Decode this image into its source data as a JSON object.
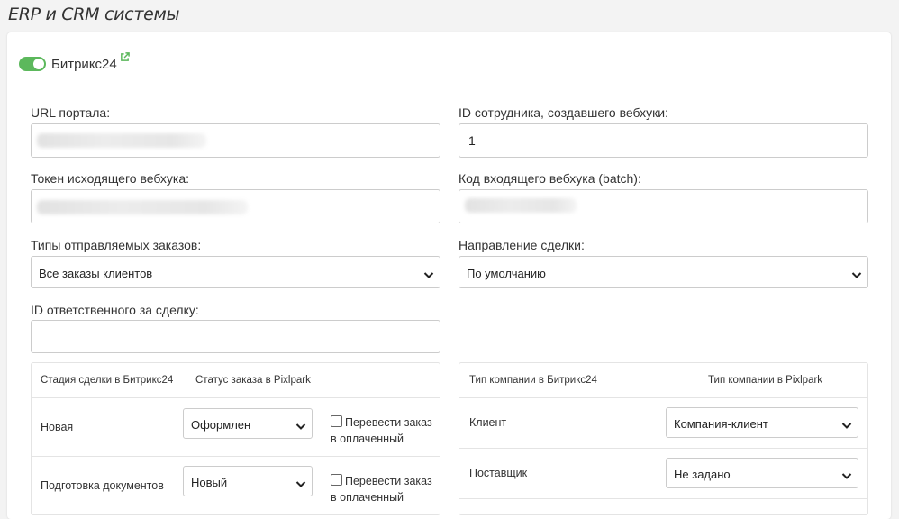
{
  "page": {
    "title": "ERP и CRM системы"
  },
  "integration": {
    "name": "Битрикс24",
    "enabled": true
  },
  "fields": {
    "portal_url": {
      "label": "URL портала:",
      "value": ""
    },
    "employee_id": {
      "label": "ID сотрудника, создавшего вебхуки:",
      "value": "1"
    },
    "outgoing_token": {
      "label": "Токен исходящего вебхука:",
      "value": ""
    },
    "incoming_code": {
      "label": "Код входящего вебхука (batch):",
      "value": ""
    },
    "order_types": {
      "label": "Типы отправляемых заказов:",
      "value": "Все заказы клиентов"
    },
    "deal_direction": {
      "label": "Направление сделки:",
      "value": "По умолчанию"
    },
    "responsible_id": {
      "label": "ID ответственного за сделку:",
      "value": ""
    }
  },
  "stages_table": {
    "headers": [
      "Стадия сделки в Битрикс24",
      "Статус заказа в Pixlpark"
    ],
    "rows": [
      {
        "stage": "Новая",
        "status": "Оформлен",
        "checkbox_label": "Перевести заказ в оплаченный"
      },
      {
        "stage": "Подготовка документов",
        "status": "Новый",
        "checkbox_label": "Перевести заказ в оплаченный"
      }
    ]
  },
  "company_table": {
    "headers": [
      "Тип компании в Битрикс24",
      "Тип компании в Pixlpark"
    ],
    "rows": [
      {
        "type": "Клиент",
        "pixlpark": "Компания-клиент"
      },
      {
        "type": "Поставщик",
        "pixlpark": "Не задано"
      }
    ]
  },
  "colors": {
    "toggle": "#5cb85c",
    "border": "#cccccc",
    "link_icon": "#5cb85c"
  }
}
